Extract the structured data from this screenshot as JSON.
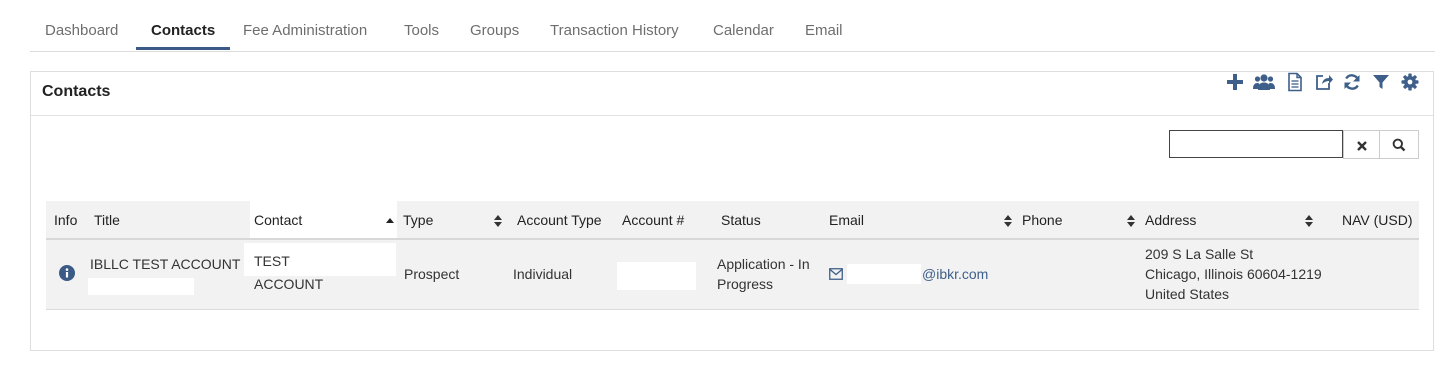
{
  "tabs": [
    {
      "label": "Dashboard"
    },
    {
      "label": "Contacts"
    },
    {
      "label": "Fee Administration"
    },
    {
      "label": "Tools"
    },
    {
      "label": "Groups"
    },
    {
      "label": "Transaction History"
    },
    {
      "label": "Calendar"
    },
    {
      "label": "Email"
    }
  ],
  "active_tab": "Contacts",
  "panel": {
    "title": "Contacts",
    "toolbar_icons": [
      "add-icon",
      "users-icon",
      "document-icon",
      "export-icon",
      "refresh-icon",
      "filter-icon",
      "gear-icon"
    ]
  },
  "search": {
    "value": "",
    "clear_icon": "close-icon",
    "search_icon": "search-icon"
  },
  "table": {
    "headers": {
      "info": "Info",
      "title": "Title",
      "contact": "Contact",
      "type": "Type",
      "account_type": "Account Type",
      "account_no": "Account #",
      "status": "Status",
      "email": "Email",
      "phone": "Phone",
      "address": "Address",
      "nav": "NAV (USD)"
    },
    "rows": [
      {
        "title": "IBLLC TEST ACCOUNT",
        "contact_line1": "TEST",
        "contact_line2": "ACCOUNT",
        "type": "Prospect",
        "account_type": "Individual",
        "account_no": "",
        "status_line1": "Application - In",
        "status_line2": "Progress",
        "email": "@ibkr.com",
        "phone": "",
        "address_line1": "209 S La Salle St",
        "address_line2": "Chicago, Illinois 60604-1219",
        "address_line3": "United States",
        "nav": ""
      }
    ]
  },
  "colors": {
    "accent": "#3b5a85",
    "icon": "#3e5f8a",
    "header_bg": "#f2f2f2"
  }
}
